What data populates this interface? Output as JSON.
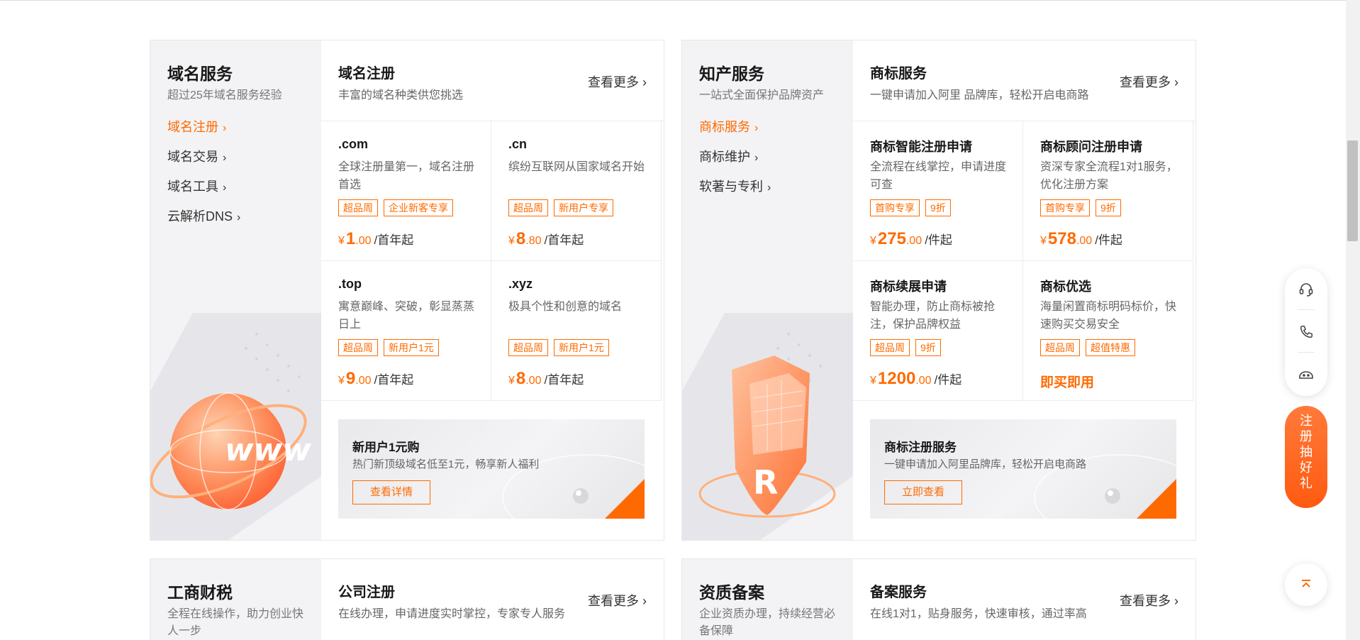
{
  "domain_panel": {
    "side": {
      "title": "域名服务",
      "subtitle": "超过25年域名服务经验",
      "nav": [
        "域名注册",
        "域名交易",
        "域名工具",
        "云解析DNS"
      ]
    },
    "header": {
      "title": "域名注册",
      "subtitle": "丰富的域名种类供您挑选",
      "more": "查看更多"
    },
    "cells": [
      {
        "title": ".com",
        "desc": "全球注册量第一，域名注册首选",
        "tags": [
          "超品周",
          "企业新客专享"
        ],
        "price_int": "1",
        "price_dec": ".00",
        "unit": "/首年起"
      },
      {
        "title": ".cn",
        "desc": "缤纷互联网从国家域名开始",
        "tags": [
          "超品周",
          "新用户专享"
        ],
        "price_int": "8",
        "price_dec": ".80",
        "unit": "/首年起"
      },
      {
        "title": ".top",
        "desc": "寓意巅峰、突破，彰显蒸蒸日上",
        "tags": [
          "超品周",
          "新用户1元"
        ],
        "price_int": "9",
        "price_dec": ".00",
        "unit": "/首年起"
      },
      {
        "title": ".xyz",
        "desc": "极具个性和创意的域名",
        "tags": [
          "超品周",
          "新用户1元"
        ],
        "price_int": "8",
        "price_dec": ".00",
        "unit": "/首年起"
      }
    ],
    "banner": {
      "title": "新用户1元购",
      "subtitle": "热门新顶级域名低至1元，畅享新人福利",
      "button": "查看详情"
    }
  },
  "ip_panel": {
    "side": {
      "title": "知产服务",
      "subtitle": "一站式全面保护品牌资产",
      "nav": [
        "商标服务",
        "商标维护",
        "软著与专利"
      ]
    },
    "header": {
      "title": "商标服务",
      "subtitle": "一键申请加入阿里 品牌库，轻松开启电商路",
      "more": "查看更多"
    },
    "cells": [
      {
        "title": "商标智能注册申请",
        "desc": "全流程在线掌控，申请进度可查",
        "tags": [
          "首购专享",
          "9折"
        ],
        "price_int": "275",
        "price_dec": ".00",
        "unit": "/件起"
      },
      {
        "title": "商标顾问注册申请",
        "desc": "资深专家全流程1对1服务，优化注册方案",
        "tags": [
          "首购专享",
          "9折"
        ],
        "price_int": "578",
        "price_dec": ".00",
        "unit": "/件起"
      },
      {
        "title": "商标续展申请",
        "desc": "智能办理，防止商标被抢注，保护品牌权益",
        "tags": [
          "超品周",
          "9折"
        ],
        "price_int": "1200",
        "price_dec": ".00",
        "unit": "/件起"
      },
      {
        "title": "商标优选",
        "desc": "海量闲置商标明码标价，快速购买交易安全",
        "tags": [
          "超品周",
          "超值特惠"
        ],
        "buy": "即买即用"
      }
    ],
    "banner": {
      "title": "商标注册服务",
      "subtitle": "一键申请加入阿里品牌库，轻松开启电商路",
      "button": "立即查看"
    }
  },
  "biz_panel": {
    "side": {
      "title": "工商财税",
      "subtitle": "全程在线操作，助力创业快人一步"
    },
    "header": {
      "title": "公司注册",
      "subtitle": "在线办理，申请进度实时掌控，专家专人服务",
      "more": "查看更多"
    }
  },
  "icp_panel": {
    "side": {
      "title": "资质备案",
      "subtitle": "企业资质办理，持续经营必备保障"
    },
    "header": {
      "title": "备案服务",
      "subtitle": "在线1对1，贴身服务，快速审核，通过率高",
      "more": "查看更多"
    }
  },
  "currency": "¥",
  "chevron": "›",
  "float_bar": {
    "icons": [
      "headset-icon",
      "phone-icon",
      "chat-bot-icon"
    ],
    "register_label": "注册抽好礼",
    "top_icon": "back-to-top-icon"
  },
  "accent_color": "#ff6a00"
}
